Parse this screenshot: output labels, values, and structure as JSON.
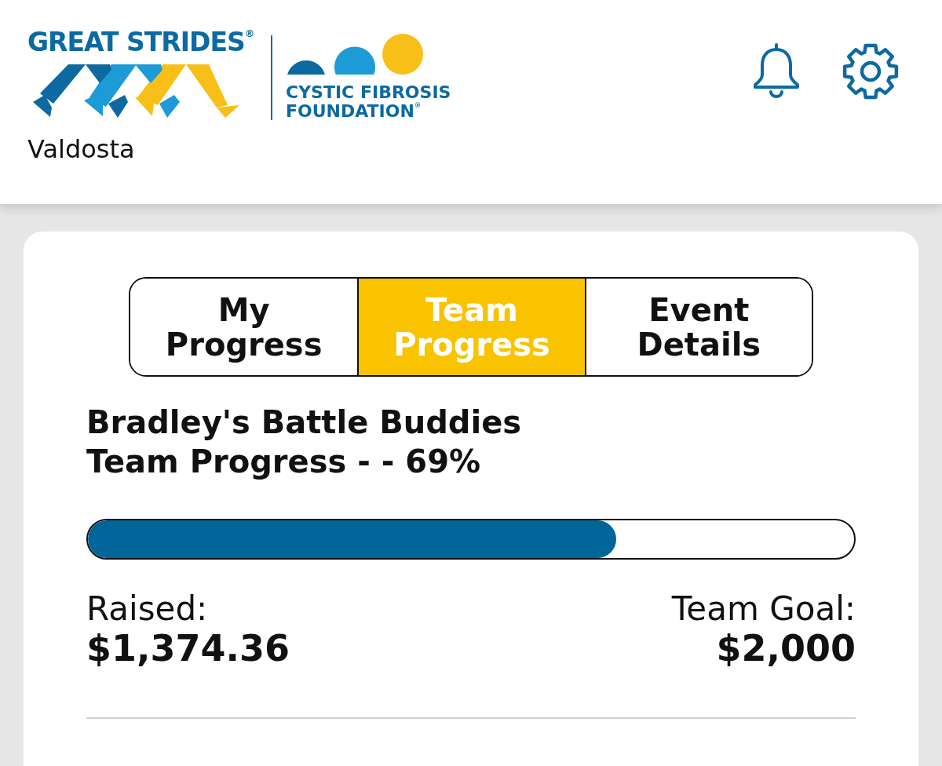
{
  "header": {
    "logo": {
      "wordmark": "GREAT STRIDES$^{®}$",
      "org_name_lines": [
        "CYSTIC FIBROSIS",
        "FOUNDATION$^{®}$"
      ]
    },
    "location": "Valdosta"
  },
  "tabs": [
    {
      "label": "My Progress",
      "selected": false
    },
    {
      "label": "Team Progress",
      "selected": true
    },
    {
      "label": "Event Details",
      "selected": false
    }
  ],
  "team_progress": {
    "team_name": "Bradley's Battle Buddies",
    "progress_text": "Team Progress - - 69%",
    "level": 0.69,
    "raised_label": "Raised:",
    "raised_amount": "$1,374.36",
    "goal_label": "Team Goal:",
    "goal_amount": "$2,000"
  }
}
